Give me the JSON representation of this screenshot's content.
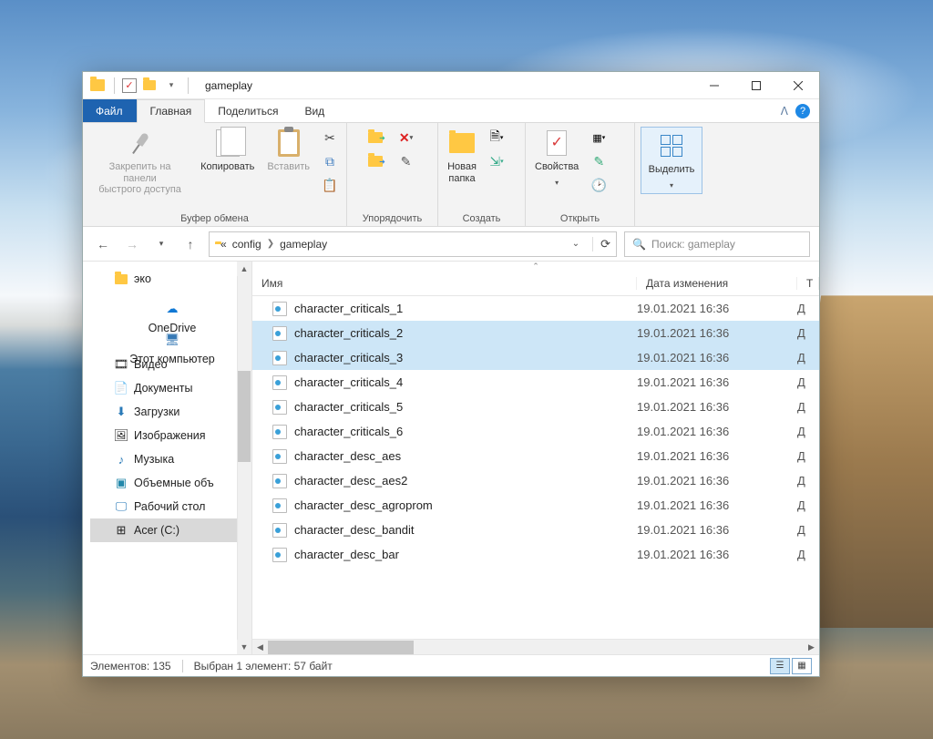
{
  "titlebar": {
    "title": "gameplay"
  },
  "tabs": {
    "file": "Файл",
    "home": "Главная",
    "share": "Поделиться",
    "view": "Вид"
  },
  "ribbon": {
    "pin": "Закрепить на панели\nбыстрого доступа",
    "copy": "Копировать",
    "paste": "Вставить",
    "group_clipboard": "Буфер обмена",
    "group_organize": "Упорядочить",
    "newfolder": "Новая\nпапка",
    "group_create": "Создать",
    "properties": "Свойства",
    "group_open": "Открыть",
    "select": "Выделить",
    "select_caret": "▾"
  },
  "address": {
    "prefix": "«",
    "seg1": "config",
    "seg2": "gameplay"
  },
  "search": {
    "placeholder": "Поиск: gameplay"
  },
  "nav": {
    "eco": "эко",
    "onedrive": "OneDrive",
    "thispc": "Этот компьютер",
    "video": "Видео",
    "documents": "Документы",
    "downloads": "Загрузки",
    "pictures": "Изображения",
    "music": "Музыка",
    "objects3d": "Объемные объ",
    "desktop": "Рабочий стол",
    "drive_c": "Acer (C:)"
  },
  "columns": {
    "name": "Имя",
    "date": "Дата изменения",
    "type": "Т"
  },
  "files": [
    {
      "name": "character_criticals_1",
      "date": "19.01.2021 16:36",
      "type": "Д",
      "selected": false
    },
    {
      "name": "character_criticals_2",
      "date": "19.01.2021 16:36",
      "type": "Д",
      "selected": true
    },
    {
      "name": "character_criticals_3",
      "date": "19.01.2021 16:36",
      "type": "Д",
      "selected": true
    },
    {
      "name": "character_criticals_4",
      "date": "19.01.2021 16:36",
      "type": "Д",
      "selected": false
    },
    {
      "name": "character_criticals_5",
      "date": "19.01.2021 16:36",
      "type": "Д",
      "selected": false
    },
    {
      "name": "character_criticals_6",
      "date": "19.01.2021 16:36",
      "type": "Д",
      "selected": false
    },
    {
      "name": "character_desc_aes",
      "date": "19.01.2021 16:36",
      "type": "Д",
      "selected": false
    },
    {
      "name": "character_desc_aes2",
      "date": "19.01.2021 16:36",
      "type": "Д",
      "selected": false
    },
    {
      "name": "character_desc_agroprom",
      "date": "19.01.2021 16:36",
      "type": "Д",
      "selected": false
    },
    {
      "name": "character_desc_bandit",
      "date": "19.01.2021 16:36",
      "type": "Д",
      "selected": false
    },
    {
      "name": "character_desc_bar",
      "date": "19.01.2021 16:36",
      "type": "Д",
      "selected": false
    }
  ],
  "status": {
    "count": "Элементов: 135",
    "selection": "Выбран 1 элемент: 57 байт"
  }
}
